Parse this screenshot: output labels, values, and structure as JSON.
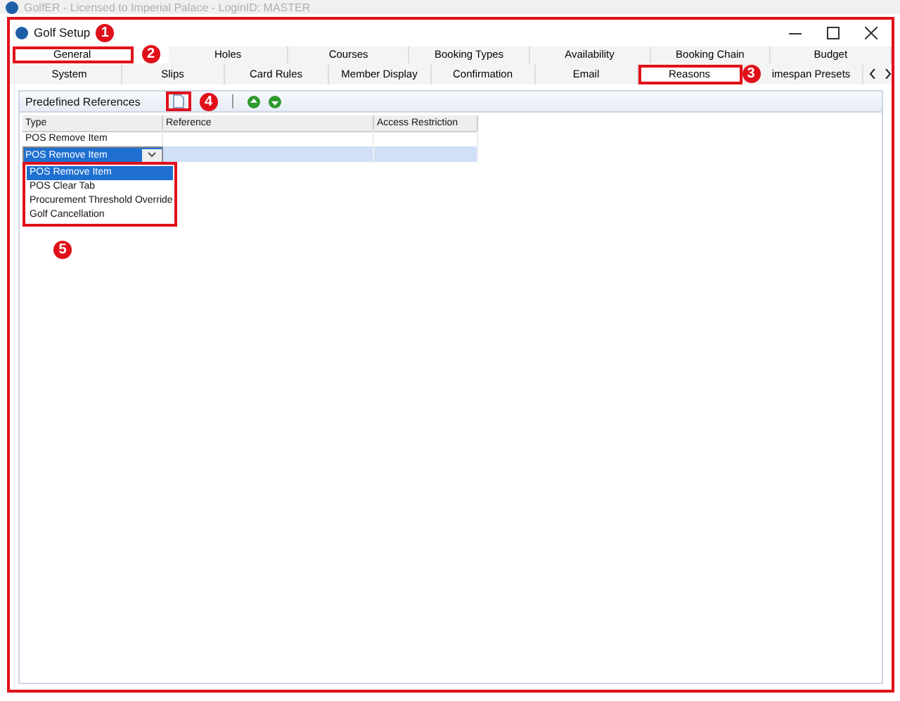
{
  "background_window": {
    "title": "GolfER - Licensed to Imperial Palace - LoginID: MASTER"
  },
  "window": {
    "title": "Golf Setup"
  },
  "callouts": [
    "1",
    "2",
    "3",
    "4",
    "5"
  ],
  "tabs_row_1": [
    {
      "label": "General",
      "selected": true
    },
    {
      "label": "Holes",
      "selected": false
    },
    {
      "label": "Courses",
      "selected": false
    },
    {
      "label": "Booking Types",
      "selected": false
    },
    {
      "label": "Availability",
      "selected": false
    },
    {
      "label": "Booking Chain",
      "selected": false
    },
    {
      "label": "Budget",
      "selected": false
    }
  ],
  "tabs_row_2": [
    {
      "label": "System",
      "selected": false
    },
    {
      "label": "Slips",
      "selected": false
    },
    {
      "label": "Card Rules",
      "selected": false
    },
    {
      "label": "Member Display",
      "selected": false
    },
    {
      "label": "Confirmation",
      "selected": false
    },
    {
      "label": "Email",
      "selected": false
    },
    {
      "label": "Reasons",
      "selected": true
    },
    {
      "label": "imespan Presets",
      "selected": false
    }
  ],
  "toolbar": {
    "title": "Predefined References"
  },
  "table": {
    "columns": [
      "Type",
      "Reference",
      "Access Restriction"
    ],
    "rows": [
      {
        "cells": [
          "POS Remove Item",
          "",
          ""
        ],
        "selected": false
      },
      {
        "cells": [
          "POS Remove Item",
          "",
          ""
        ],
        "selected": true
      }
    ]
  },
  "dropdown": {
    "options": [
      {
        "label": "POS Remove Item",
        "selected": true
      },
      {
        "label": "POS Clear Tab",
        "selected": false
      },
      {
        "label": "Procurement Threshold Override",
        "selected": false
      },
      {
        "label": "Golf Cancellation",
        "selected": false
      }
    ]
  }
}
